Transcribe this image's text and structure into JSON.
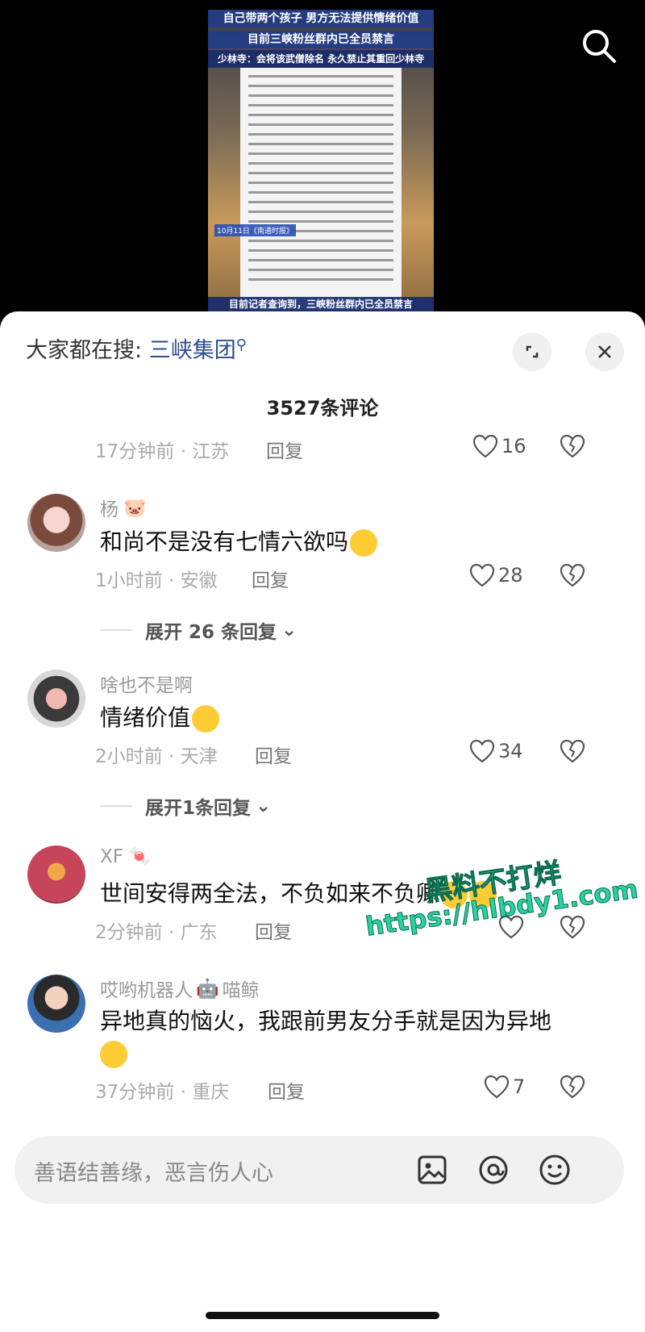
{
  "video": {
    "banner_line1": "自己带两个孩子 男方无法提供情绪价值",
    "banner_line2": "目前三峡粉丝群内已全员禁言",
    "banner_line3": "少林寺：会将该武僧除名 永久禁止其重回少林寺",
    "date_tag": "10月11日《南通时报》",
    "bottom_banner": "目前记者查询到，三峡粉丝群内已全员禁言"
  },
  "panel": {
    "trending_prefix": "大家都在搜:",
    "trending_keyword": "三峡集团",
    "comment_count": "3527条评论",
    "reply_label": "回复"
  },
  "comments": [
    {
      "time_location": "17分钟前 · 江苏",
      "likes": "16"
    },
    {
      "username": "杨",
      "text": "和尚不是没有七情六欲吗",
      "time_location": "1小时前 · 安徽",
      "likes": "28",
      "expand": "展开 26 条回复"
    },
    {
      "username": "啥也不是啊",
      "text": "情绪价值",
      "time_location": "2小时前 · 天津",
      "likes": "34",
      "expand": "展开1条回复"
    },
    {
      "username": "XF",
      "text": "世间安得两全法，不负如来不负卿",
      "time_location": "2分钟前 · 广东",
      "likes": ""
    },
    {
      "username": "哎哟机器人",
      "username_suffix": "喵鲸",
      "text": "异地真的恼火，我跟前男友分手就是因为异地",
      "time_location": "37分钟前 · 重庆",
      "likes": "7"
    }
  ],
  "input": {
    "placeholder": "善语结善缘，恶言伤人心"
  },
  "watermark": {
    "line1": "黑料不打烊",
    "line2": "https://hlbdy1.com"
  },
  "colors": {
    "keyword": "#2e4f8c",
    "watermark": "#27d3a0"
  }
}
